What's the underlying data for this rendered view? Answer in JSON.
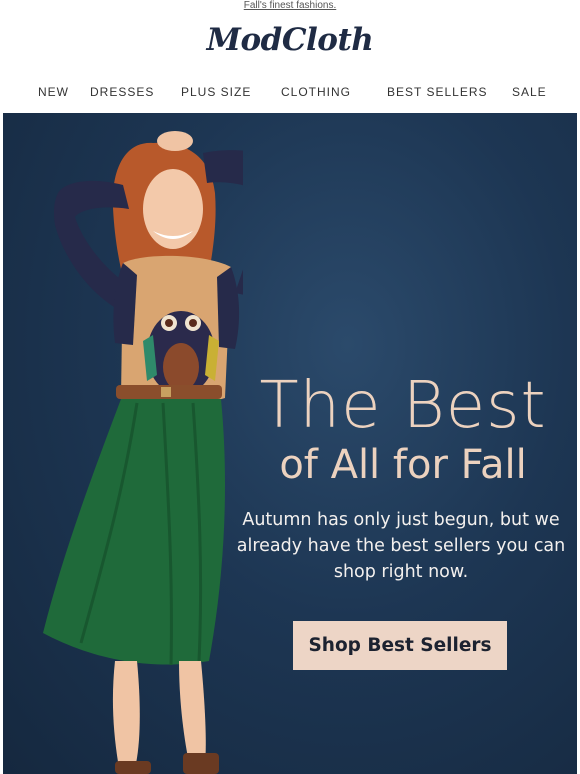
{
  "preheader": "Fall's finest fashions.",
  "brand": {
    "logo_text": "ModCloth"
  },
  "nav": {
    "items": [
      "NEW",
      "DRESSES",
      "PLUS SIZE",
      "CLOTHING",
      "BEST SELLERS",
      "SALE"
    ]
  },
  "hero": {
    "headline_line1": "The Best",
    "headline_line2": "of All for Fall",
    "body_line1": "Autumn has only just begun, but we",
    "body_line2": "already have the best sellers you can",
    "body_line3": "shop right now.",
    "cta_label": "Shop Best Sellers",
    "image_subject": "model in owl sweater and green skirt"
  },
  "colors": {
    "hero_background": "#1d3653",
    "headline": "#ecd2bf",
    "cta_background": "#edd5c6",
    "logo": "#1f2b44"
  }
}
